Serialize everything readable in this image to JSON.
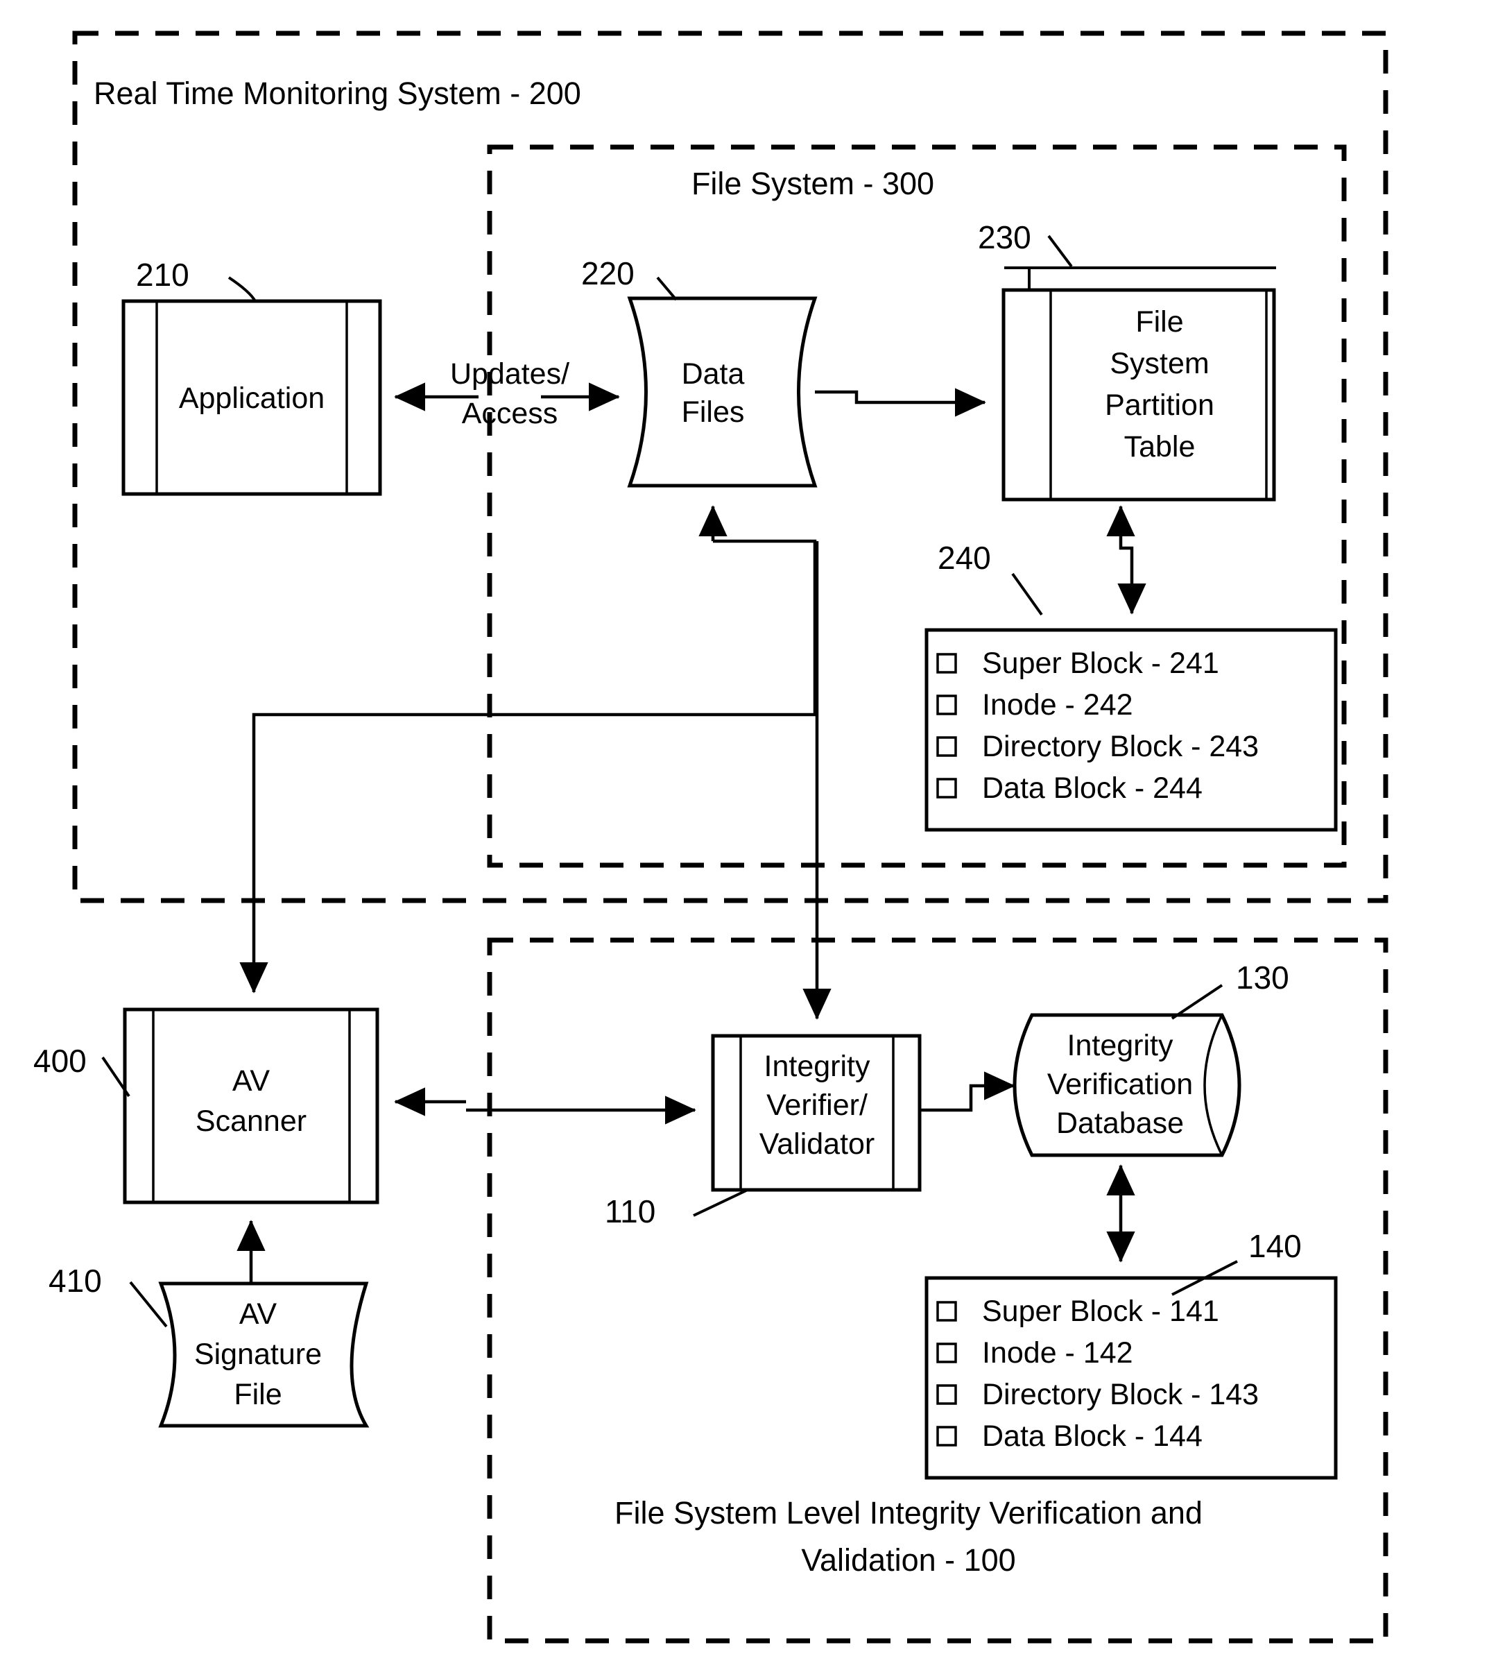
{
  "figure": {
    "title": "Real Time Monitoring System - 200",
    "regions": [
      {
        "id": "region-200",
        "label": "Real Time Monitoring System - 200"
      },
      {
        "id": "region-300",
        "label": "File System - 300"
      },
      {
        "id": "region-100",
        "label_line1": "File System Level Integrity Verification and",
        "label_line2": "Validation - 100"
      }
    ],
    "nodes": {
      "application": {
        "label": "Application",
        "ref": "210"
      },
      "data_files": {
        "label_line1": "Data",
        "label_line2": "Files",
        "ref": "220"
      },
      "partition_table": {
        "label_line1": "File",
        "label_line2": "System",
        "label_line3": "Partition",
        "label_line4": "Table",
        "ref": "230"
      },
      "av_scanner": {
        "label_line1": "AV",
        "label_line2": "Scanner",
        "ref": "400"
      },
      "av_signature_file": {
        "label_line1": "AV",
        "label_line2": "Signature",
        "label_line3": "File",
        "ref": "410"
      },
      "integrity_verifier": {
        "label_line1": "Integrity",
        "label_line2": "Verifier/",
        "label_line3": "Validator",
        "ref": "110"
      },
      "integrity_database": {
        "label_line1": "Integrity",
        "label_line2": "Verification",
        "label_line3": "Database",
        "ref": "130"
      }
    },
    "block_list_240": {
      "ref": "240",
      "items": [
        "Super Block - 241",
        "Inode - 242",
        "Directory Block - 243",
        "Data Block - 244"
      ]
    },
    "block_list_140": {
      "ref": "140",
      "items": [
        "Super Block - 141",
        "Inode - 142",
        "Directory Block - 143",
        "Data Block - 144"
      ]
    },
    "edges": {
      "updates_access_line1": "Updates/",
      "updates_access_line2": "Access"
    },
    "colors": {
      "ink": "#000000",
      "paper": "#ffffff"
    }
  }
}
